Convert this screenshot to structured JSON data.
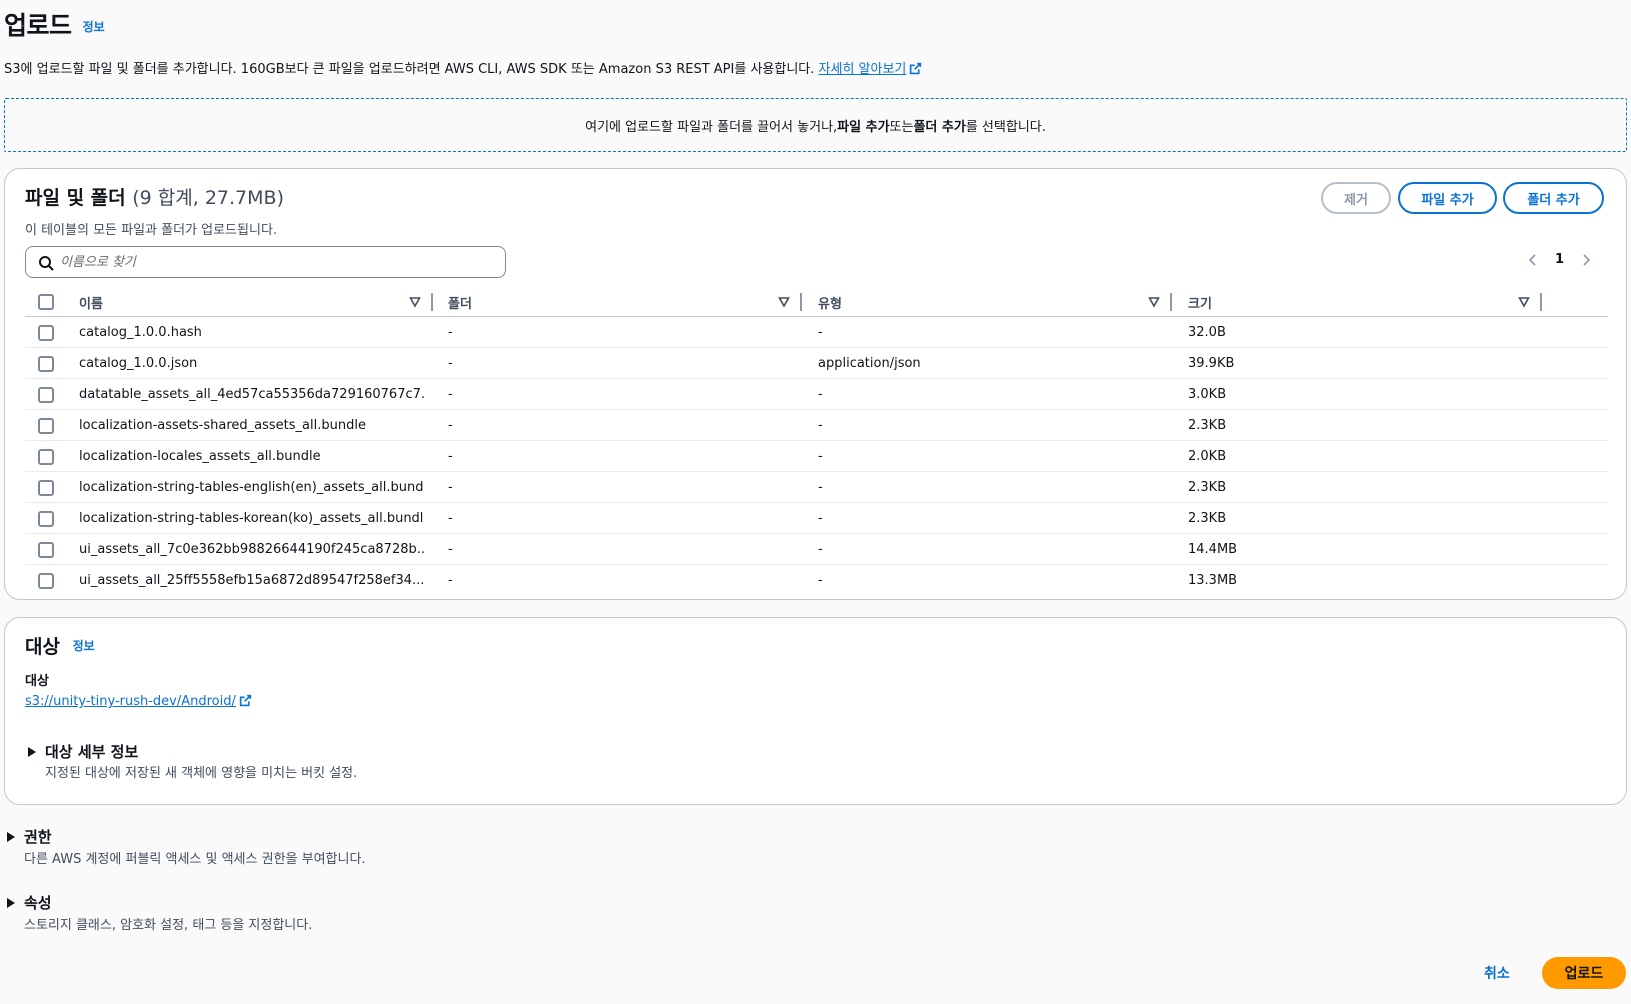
{
  "header": {
    "title": "업로드",
    "info": "정보",
    "description": "S3에 업로드할 파일 및 폴더를 추가합니다. 160GB보다 큰 파일을 업로드하려면 AWS CLI, AWS SDK 또는 Amazon S3 REST API를 사용합니다.",
    "learn_more": "자세히 알아보기"
  },
  "dropzone": {
    "text_before": "여기에 업로드할 파일과 폴더를 끌어서 놓거나, ",
    "add_files": "파일 추가",
    "or": " 또는 ",
    "add_folder": "폴더 추가",
    "text_after": "를 선택합니다."
  },
  "files_panel": {
    "title": "파일 및 폴더",
    "count": "(9 합계, 27.7MB)",
    "subtitle": "이 테이블의 모든 파일과 폴더가 업로드됩니다.",
    "remove_label": "제거",
    "add_file_label": "파일 추가",
    "add_folder_label": "폴더 추가",
    "search_placeholder": "이름으로 찾기",
    "page": "1",
    "columns": [
      "이름",
      "폴더",
      "유형",
      "크기"
    ],
    "rows": [
      {
        "name": "catalog_1.0.0.hash",
        "folder": "-",
        "type": "-",
        "size": "32.0B"
      },
      {
        "name": "catalog_1.0.0.json",
        "folder": "-",
        "type": "application/json",
        "size": "39.9KB"
      },
      {
        "name": "datatable_assets_all_4ed57ca55356da729160767c7...",
        "folder": "-",
        "type": "-",
        "size": "3.0KB"
      },
      {
        "name": "localization-assets-shared_assets_all.bundle",
        "folder": "-",
        "type": "-",
        "size": "2.3KB"
      },
      {
        "name": "localization-locales_assets_all.bundle",
        "folder": "-",
        "type": "-",
        "size": "2.0KB"
      },
      {
        "name": "localization-string-tables-english(en)_assets_all.bundle",
        "folder": "-",
        "type": "-",
        "size": "2.3KB"
      },
      {
        "name": "localization-string-tables-korean(ko)_assets_all.bundle",
        "folder": "-",
        "type": "-",
        "size": "2.3KB"
      },
      {
        "name": "ui_assets_all_7c0e362bb98826644190f245ca8728b...",
        "folder": "-",
        "type": "-",
        "size": "14.4MB"
      },
      {
        "name": "ui_assets_all_25ff5558efb15a6872d89547f258ef34....",
        "folder": "-",
        "type": "-",
        "size": "13.3MB"
      }
    ]
  },
  "target_panel": {
    "title": "대상",
    "info": "정보",
    "label": "대상",
    "link": "s3://unity-tiny-rush-dev/Android/",
    "details_title": "대상 세부 정보",
    "details_desc": "지정된 대상에 저장된 새 객체에 영향을 미치는 버킷 설정."
  },
  "permissions": {
    "title": "권한",
    "desc": "다른 AWS 계정에 퍼블릭 액세스 및 액세스 권한을 부여합니다."
  },
  "properties": {
    "title": "속성",
    "desc": "스토리지 클래스, 암호화 설정, 태그 등을 지정합니다."
  },
  "footer": {
    "cancel": "취소",
    "upload": "업로드"
  },
  "colors": {
    "link": "#0972d3",
    "primary_button": "#ff9900",
    "border": "#c6c6cd"
  }
}
